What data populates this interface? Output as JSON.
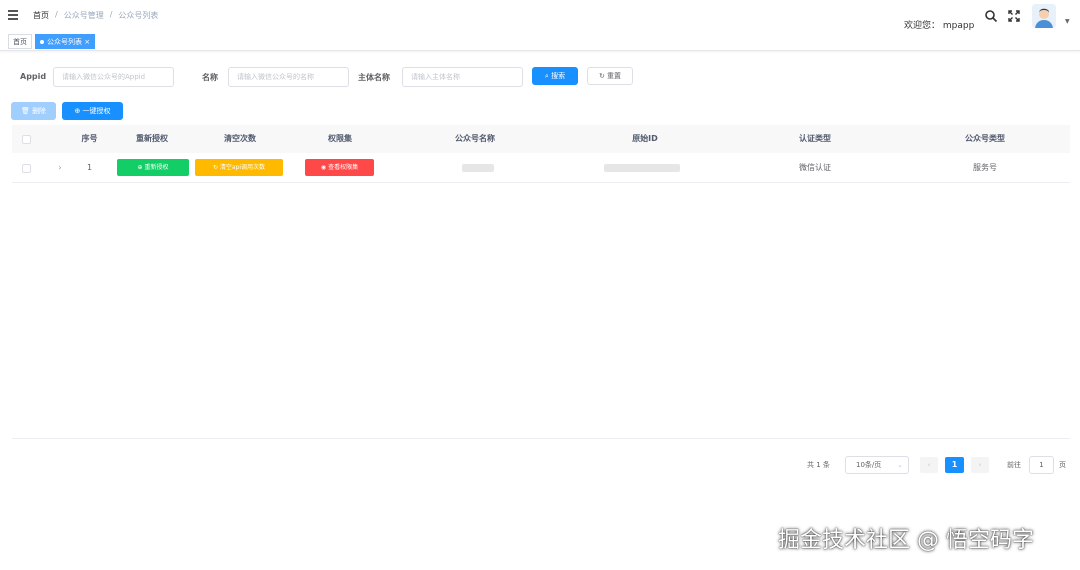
{
  "header": {
    "breadcrumb": [
      "首页",
      "/",
      "公众号管理",
      "/",
      "公众号列表"
    ],
    "welcome": "欢迎您：  mpapp",
    "icons": [
      "hamburger-icon",
      "search-icon",
      "fullscreen-icon",
      "avatar",
      "chevron-down-icon"
    ]
  },
  "tags": {
    "home": "首页",
    "active": "公众号列表",
    "close": "×"
  },
  "search": {
    "appid_label": "Appid",
    "appid_placeholder": "请输入微信公众号的Appid",
    "name_label": "名称",
    "name_placeholder": "请输入微信公众号的名称",
    "principal_label": "主体名称",
    "principal_placeholder": "请输入主体名称",
    "search_button": "搜索",
    "reset_button": "重置"
  },
  "toolbar": {
    "delete_button": "删除",
    "authorize_button": "一键授权"
  },
  "table": {
    "columns": [
      "序号",
      "重新授权",
      "清空次数",
      "权限集",
      "公众号名称",
      "原始ID",
      "认证类型",
      "公众号类型"
    ],
    "rows": [
      {
        "index": "1",
        "reauth": "重新授权",
        "clear_quota": "清空api调用次数",
        "permissions": "查看权限集",
        "name": "",
        "original_id": "",
        "verify_type": "微信认证",
        "account_type": "服务号"
      }
    ]
  },
  "pagination": {
    "total": "共 1 条",
    "page_size": "10条/页",
    "prev": "‹",
    "current": "1",
    "next": "›",
    "goto_prefix": "前往",
    "goto_value": "1",
    "goto_suffix": "页"
  },
  "watermark": "掘金技术社区 @ 悟空码字",
  "colors": {
    "primary": "#1890ff",
    "success": "#13ce66",
    "warning": "#ffba00",
    "danger": "#ff4949"
  }
}
